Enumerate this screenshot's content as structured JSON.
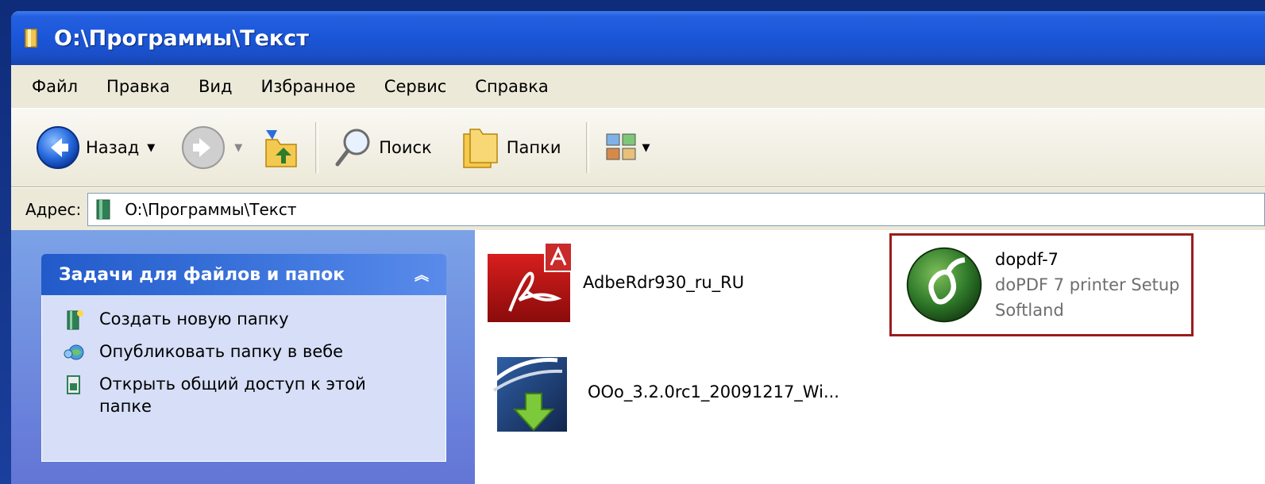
{
  "window": {
    "title": "O:\\Программы\\Текст"
  },
  "menu": {
    "items": [
      "Файл",
      "Правка",
      "Вид",
      "Избранное",
      "Сервис",
      "Справка"
    ]
  },
  "toolbar": {
    "back_label": "Назад",
    "search_label": "Поиск",
    "folders_label": "Папки"
  },
  "address": {
    "label": "Адрес:",
    "value": "O:\\Программы\\Текст"
  },
  "tasks": {
    "header": "Задачи для файлов и папок",
    "items": [
      {
        "label": "Создать новую папку",
        "icon": "new-folder-icon"
      },
      {
        "label": "Опубликовать папку в вебе",
        "icon": "publish-web-icon"
      },
      {
        "label": "Открыть общий доступ к этой папке",
        "icon": "share-folder-icon"
      }
    ]
  },
  "files": [
    {
      "name": "AdbeRdr930_ru_RU",
      "icon": "adobe-reader-icon"
    },
    {
      "name": "OOo_3.2.0rc1_20091217_Wi...",
      "icon": "openoffice-installer-icon"
    },
    {
      "name": "dopdf-7",
      "description": "doPDF 7 printer Setup",
      "company": "Softland",
      "icon": "dopdf-icon",
      "selected": true
    }
  ],
  "colors": {
    "titlebar": "#1a56d8",
    "taskpane": "#6f8fe0",
    "selection_border": "#9b1c1c"
  }
}
